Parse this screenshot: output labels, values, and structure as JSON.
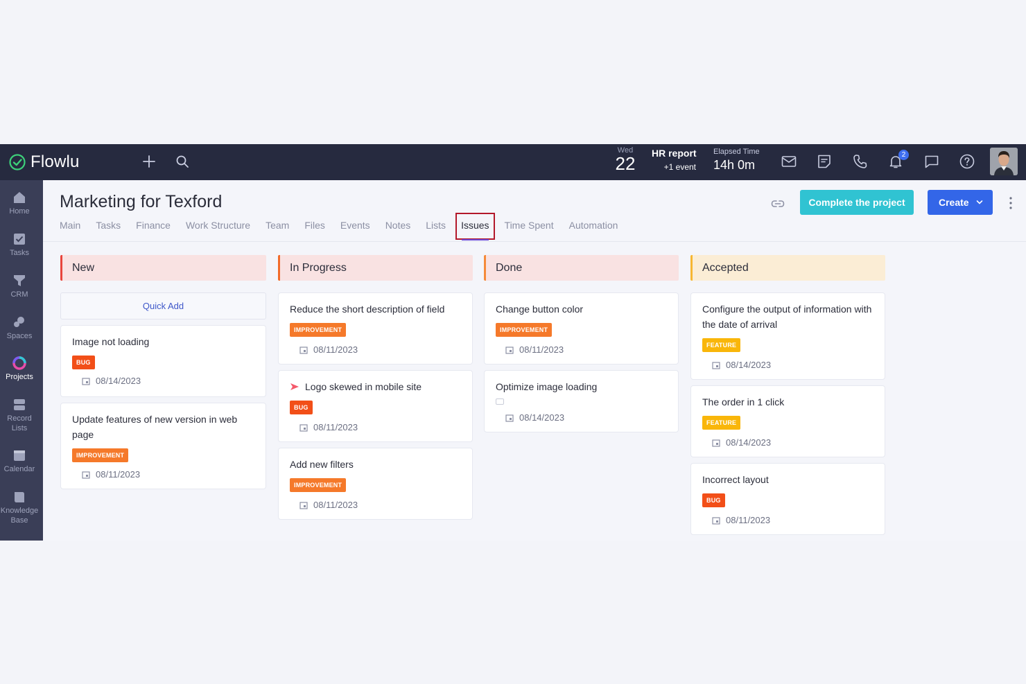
{
  "topbar": {
    "app_name": "Flowlu",
    "date_weekday": "Wed",
    "date_day": "22",
    "event_title": "HR report",
    "event_more": "+1 event",
    "elapsed_label": "Elapsed Time",
    "elapsed_value": "14h 0m",
    "notifications_count": "2",
    "icons": [
      "plus-icon",
      "search-icon",
      "mail-icon",
      "notes-icon",
      "phone-icon",
      "bell-icon",
      "chat-icon",
      "help-icon"
    ]
  },
  "sidebar": {
    "items": [
      {
        "label": "Home",
        "icon": "home-icon"
      },
      {
        "label": "Tasks",
        "icon": "tasks-icon"
      },
      {
        "label": "CRM",
        "icon": "crm-icon"
      },
      {
        "label": "Spaces",
        "icon": "spaces-icon"
      },
      {
        "label": "Projects",
        "icon": "projects-icon",
        "active": true
      },
      {
        "label": "Record Lists",
        "icon": "record-lists-icon"
      },
      {
        "label": "Calendar",
        "icon": "calendar-icon"
      },
      {
        "label": "Knowledge Base",
        "icon": "knowledge-base-icon"
      }
    ]
  },
  "page": {
    "title": "Marketing for Texford",
    "complete_button": "Complete the project",
    "create_button": "Create",
    "tabs": [
      {
        "label": "Main"
      },
      {
        "label": "Tasks"
      },
      {
        "label": "Finance"
      },
      {
        "label": "Work Structure"
      },
      {
        "label": "Team"
      },
      {
        "label": "Files"
      },
      {
        "label": "Events"
      },
      {
        "label": "Notes"
      },
      {
        "label": "Lists"
      },
      {
        "label": "Issues",
        "active": true
      },
      {
        "label": "Time Spent"
      },
      {
        "label": "Automation"
      }
    ]
  },
  "board": {
    "quick_add": "Quick Add",
    "columns": [
      {
        "title": "New",
        "accent": "#e8453c",
        "cards": [
          {
            "title": "Image not loading",
            "tag": "BUG",
            "date": "08/14/2023"
          },
          {
            "title": "Update features of new version in web page",
            "tag": "IMPROVEMENT",
            "date": "08/11/2023"
          }
        ]
      },
      {
        "title": "In Progress",
        "accent": "#f26b2a",
        "cards": [
          {
            "title": "Reduce the short description of field",
            "tag": "IMPROVEMENT",
            "date": "08/11/2023"
          },
          {
            "title": "Logo skewed in mobile site",
            "tag": "BUG",
            "date": "08/11/2023"
          },
          {
            "title": "Add new filters",
            "tag": "IMPROVEMENT",
            "date": "08/11/2023"
          }
        ]
      },
      {
        "title": "Done",
        "accent": "#f58a3a",
        "cards": [
          {
            "title": "Change button color",
            "tag": "IMPROVEMENT",
            "date": "08/11/2023"
          },
          {
            "title": "Optimize image loading",
            "date": "08/14/2023"
          }
        ]
      },
      {
        "title": "Accepted",
        "accent": "#f7b731",
        "cards": [
          {
            "title": "Configure the output of information with the date of arrival",
            "tag": "FEATURE",
            "date": "08/14/2023"
          },
          {
            "title": "The order in 1 click",
            "tag": "FEATURE",
            "date": "08/14/2023"
          },
          {
            "title": "Incorrect layout",
            "tag": "BUG",
            "date": "08/11/2023"
          }
        ]
      }
    ]
  },
  "colors": {
    "topbar": "#262a3f",
    "sidebar": "#3a3e57",
    "primary_button": "#3366e8",
    "complete_button": "#30c3d2",
    "bug": "#f24f18",
    "improvement": "#f5792a",
    "feature": "#f9b60a"
  }
}
